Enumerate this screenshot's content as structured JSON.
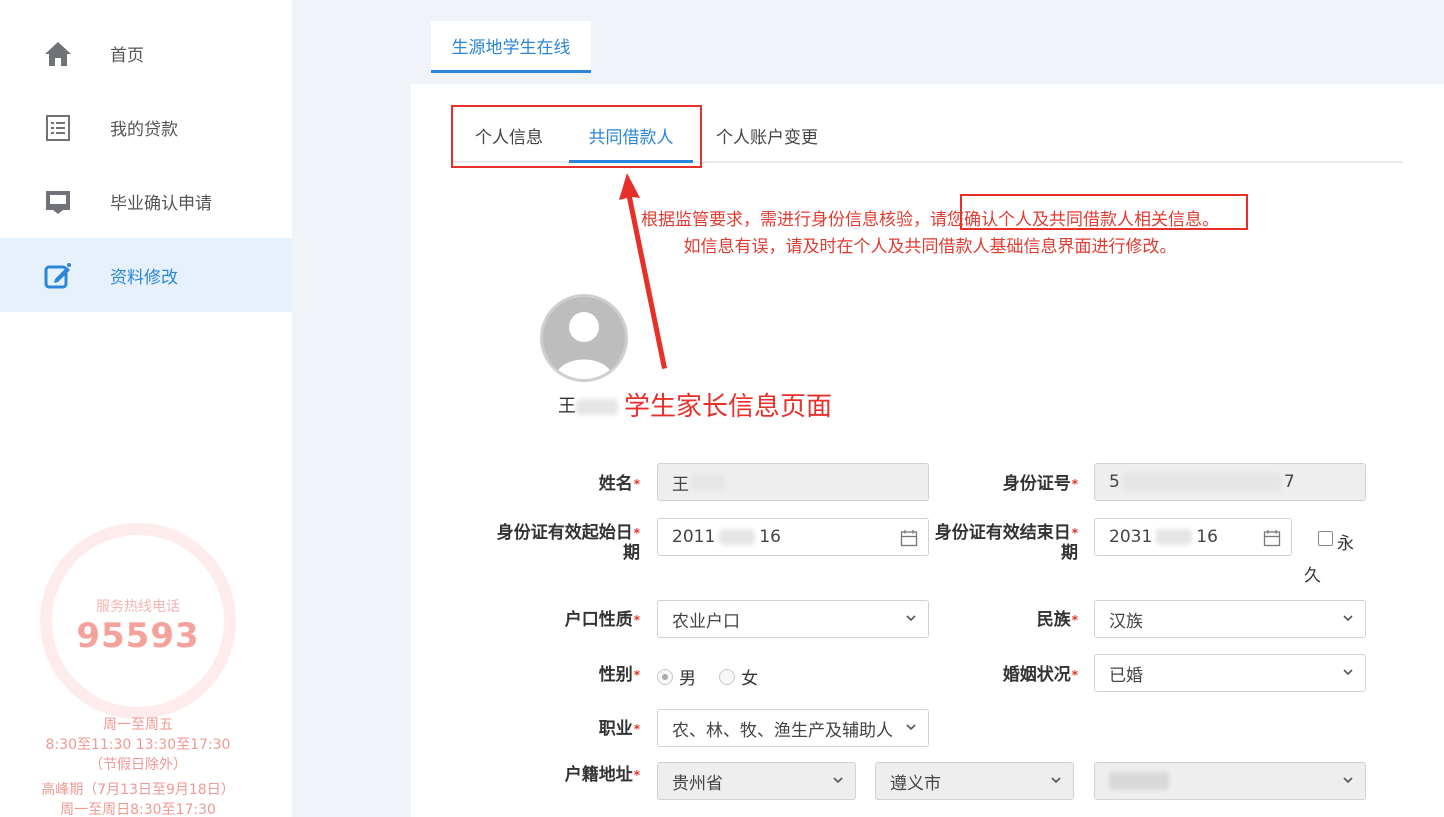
{
  "sidebar": {
    "items": [
      {
        "label": "首页",
        "icon": "home-icon"
      },
      {
        "label": "我的贷款",
        "icon": "list-icon"
      },
      {
        "label": "毕业确认申请",
        "icon": "inbox-icon"
      },
      {
        "label": "资料修改",
        "icon": "edit-icon",
        "active": true
      }
    ],
    "hotline": {
      "title": "服务热线电话",
      "number": "95593",
      "hours": [
        "周一至周五",
        "8:30至11:30 13:30至17:30",
        "（节假日除外）",
        "高峰期（7月13日至9月18日）",
        "周一至周日8:30至17:30"
      ]
    }
  },
  "top_tab": "生源地学生在线",
  "sub_tabs": [
    "个人信息",
    "共同借款人",
    "个人账户变更"
  ],
  "notice": {
    "line1": "根据监管要求，需进行身份信息核验，请您确认个人及共同借款人相关信息。",
    "line2": "如信息有误，请及时在个人及共同借款人基础信息界面进行修改。"
  },
  "profile": {
    "name_prefix": "王"
  },
  "annotation": "学生家长信息页面",
  "form": {
    "name_label": "姓名",
    "name_value": "王",
    "id_label": "身份证号",
    "id_prefix": "5",
    "id_suffix": "7",
    "id_start_label_1": "身份证有效起始日",
    "id_start_label_2": "期",
    "id_start_prefix": "2011",
    "id_start_suffix": "16",
    "id_end_label_1": "身份证有效结束日",
    "id_end_label_2": "期",
    "id_end_prefix": "2031",
    "id_end_suffix": "16",
    "permanent_label_1": "永",
    "permanent_label_2": "久",
    "hukou_label": "户口性质",
    "hukou_value": "农业户口",
    "ethnic_label": "民族",
    "ethnic_value": "汉族",
    "gender_label": "性别",
    "gender_male": "男",
    "gender_female": "女",
    "marital_label": "婚姻状况",
    "marital_value": "已婚",
    "job_label": "职业",
    "job_value": "农、林、牧、渔生产及辅助人",
    "address_label": "户籍地址",
    "province": "贵州省",
    "city": "遵义市"
  },
  "colors": {
    "accent": "#2b86d9",
    "annotation": "#e8302b",
    "hotline": "#f4a29b"
  }
}
